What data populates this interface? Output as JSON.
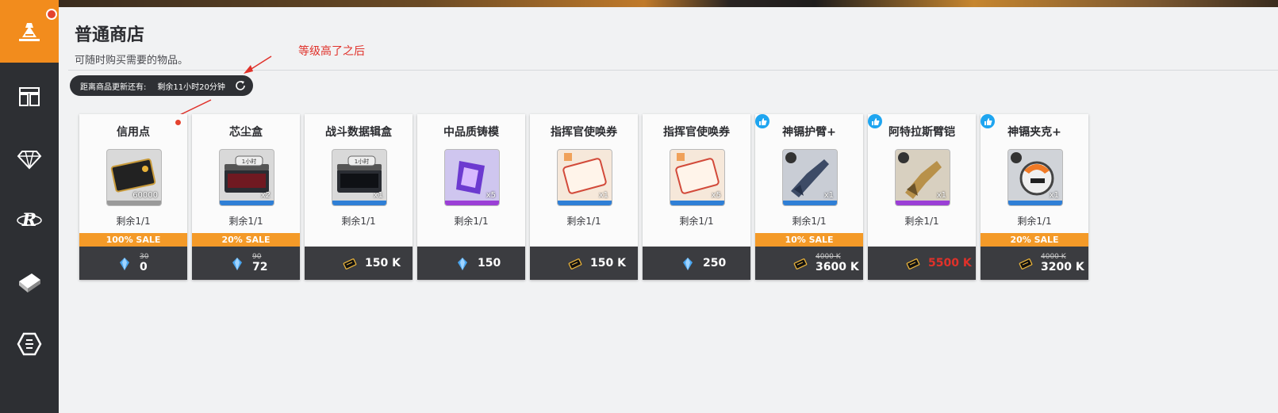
{
  "sidebar": {
    "items": [
      {
        "icon": "shop-icon"
      },
      {
        "icon": "store-icon"
      },
      {
        "icon": "diamond-icon"
      },
      {
        "icon": "r-emblem-icon"
      },
      {
        "icon": "box-icon"
      },
      {
        "icon": "hexagon-icon"
      }
    ]
  },
  "header": {
    "title": "普通商店",
    "subtitle": "可随时购买需要的物品。"
  },
  "annotation": "等级高了之后",
  "refresh": {
    "label": "距离商品更新还有:",
    "time": "剩余11小时20分钟"
  },
  "cards": [
    {
      "name": "信用点",
      "qty": "60000",
      "remain": "剩余1/1",
      "sale": "100% SALE",
      "old_price": "30",
      "price": "0",
      "currency": "crystal-icon",
      "featured": false,
      "strip": "#9a9a9a"
    },
    {
      "name": "芯尘盒",
      "qty": "x2",
      "remain": "剩余1/1",
      "sale": "20% SALE",
      "old_price": "90",
      "price": "72",
      "currency": "crystal-icon",
      "featured": false,
      "strip": "#2f7fd6",
      "tag": "1小时"
    },
    {
      "name": "战斗数据辑盒",
      "qty": "x1",
      "remain": "剩余1/1",
      "sale": "",
      "old_price": "",
      "price": "150 K",
      "currency": "credit-chip-icon",
      "featured": false,
      "strip": "#2f7fd6",
      "tag": "1小时"
    },
    {
      "name": "中品质铸模",
      "qty": "x5",
      "remain": "剩余1/1",
      "sale": "",
      "old_price": "",
      "price": "150",
      "currency": "crystal-icon",
      "featured": false,
      "strip": "#9b3fd6"
    },
    {
      "name": "指挥官使唤券",
      "qty": "x1",
      "remain": "剩余1/1",
      "sale": "",
      "old_price": "",
      "price": "150 K",
      "currency": "credit-chip-icon",
      "featured": false,
      "strip": "#2f7fd6"
    },
    {
      "name": "指挥官使唤券",
      "qty": "x5",
      "remain": "剩余1/1",
      "sale": "",
      "old_price": "",
      "price": "250",
      "currency": "crystal-icon",
      "featured": false,
      "strip": "#2f7fd6"
    },
    {
      "name": "神镉护臂+",
      "qty": "x1",
      "remain": "剩余1/1",
      "sale": "10% SALE",
      "old_price": "4000 K",
      "price": "3600 K",
      "currency": "credit-chip-icon",
      "featured": true,
      "strip": "#2f7fd6"
    },
    {
      "name": "阿特拉斯臂铠",
      "qty": "x1",
      "remain": "剩余1/1",
      "sale": "",
      "old_price": "",
      "price": "5500 K",
      "currency": "credit-chip-icon",
      "featured": true,
      "strip": "#9b3fd6",
      "price_red": true
    },
    {
      "name": "神镉夹克+",
      "qty": "x1",
      "remain": "剩余1/1",
      "sale": "20% SALE",
      "old_price": "4000 K",
      "price": "3200 K",
      "currency": "credit-chip-icon",
      "featured": true,
      "strip": "#2f7fd6"
    }
  ]
}
